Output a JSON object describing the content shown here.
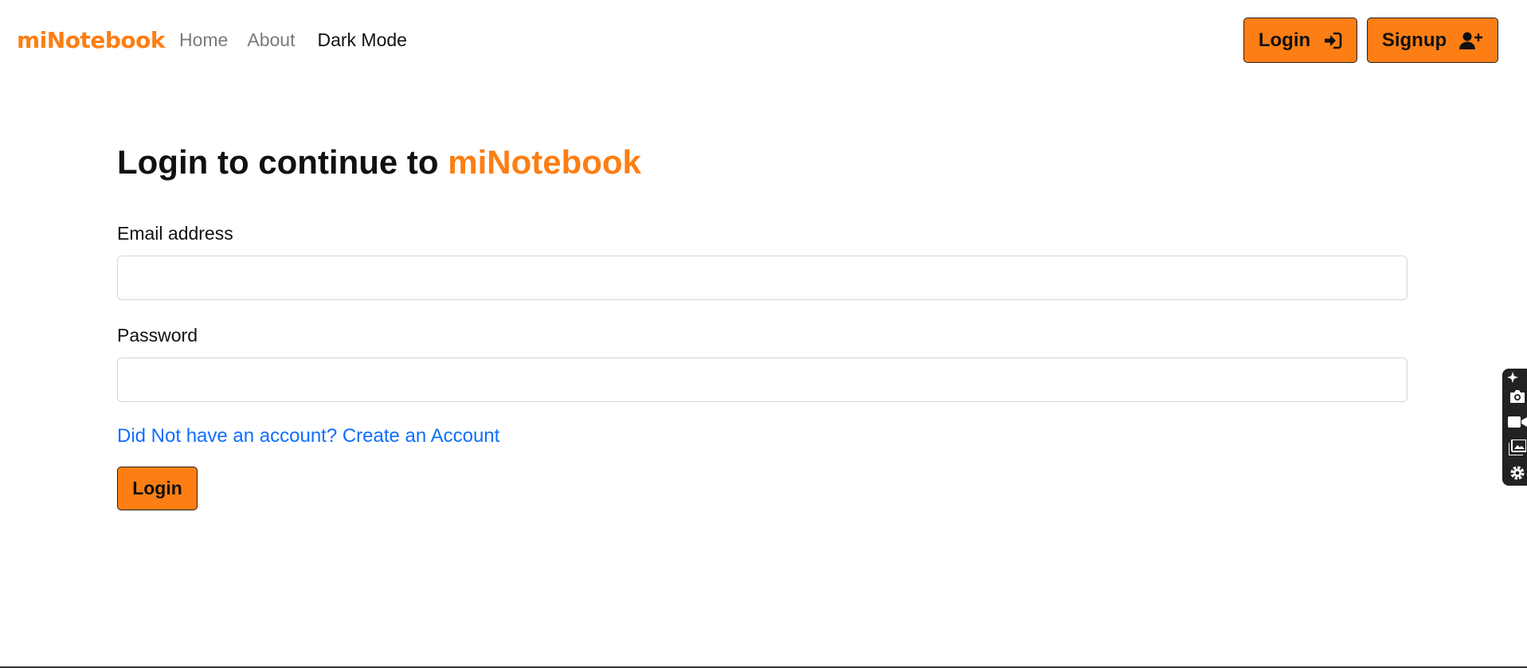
{
  "colors": {
    "accent": "#fd7e14",
    "link": "#0d6efd",
    "muted": "#7a7a7a"
  },
  "navbar": {
    "brand": "miNotebook",
    "links": [
      {
        "label": "Home"
      },
      {
        "label": "About"
      },
      {
        "label": "Dark Mode"
      }
    ],
    "login_button": {
      "label": "Login",
      "icon": "sign-in-icon"
    },
    "signup_button": {
      "label": "Signup",
      "icon": "user-plus-icon"
    }
  },
  "main": {
    "title_prefix": "Login to continue to",
    "title_accent": "miNotebook",
    "email": {
      "label": "Email address",
      "value": "",
      "placeholder": ""
    },
    "password": {
      "label": "Password",
      "value": "",
      "placeholder": ""
    },
    "signup_link": "Did Not have an account? Create an Account",
    "submit_label": "Login"
  },
  "side_toolbar": {
    "icons": [
      "sparkle-icon",
      "camera-icon",
      "video-icon",
      "gallery-icon",
      "gear-icon"
    ]
  }
}
